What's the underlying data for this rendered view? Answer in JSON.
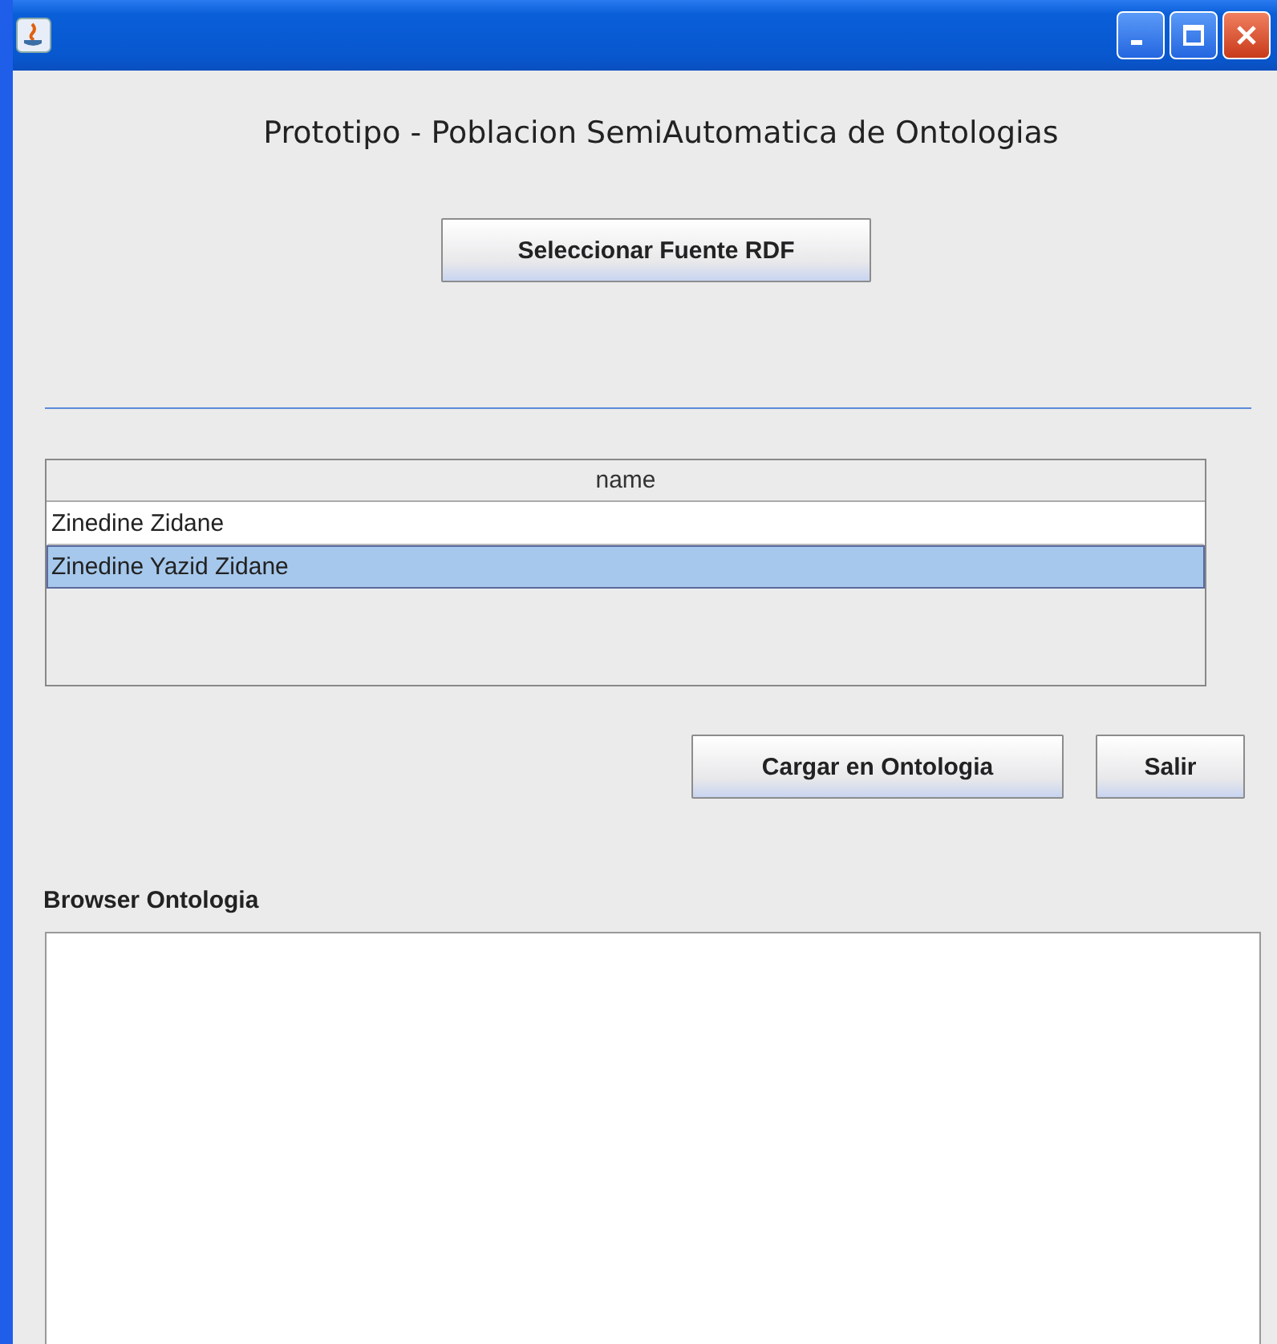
{
  "heading": "Prototipo - Poblacion SemiAutomatica de Ontologias",
  "select_button": "Seleccionar Fuente RDF",
  "table": {
    "columns": [
      "name"
    ],
    "rows": [
      {
        "cells": [
          "Zinedine Zidane"
        ],
        "selected": false
      },
      {
        "cells": [
          "Zinedine Yazid Zidane"
        ],
        "selected": true
      }
    ]
  },
  "buttons": [
    "Cargar en Ontologia",
    "Salir"
  ],
  "browser": {
    "label": "Browser Ontologia"
  }
}
